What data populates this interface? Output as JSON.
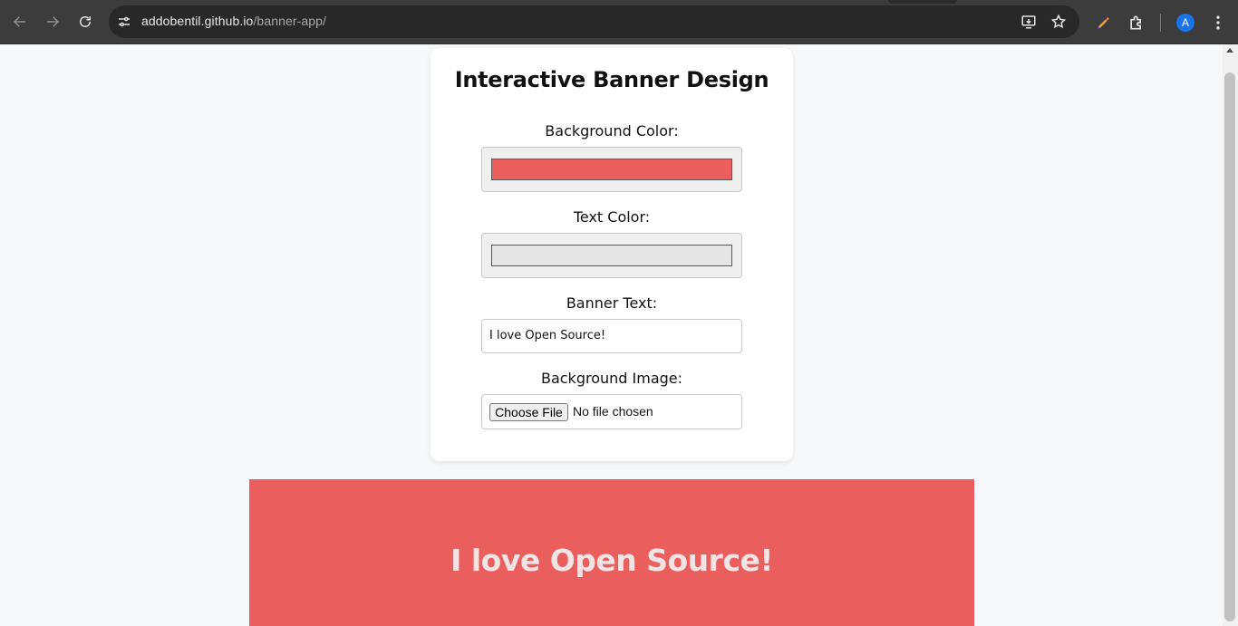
{
  "browser": {
    "url_host": "addobentil.github.io",
    "url_path": "/banner-app/",
    "profile_initial": "A",
    "icons": {
      "back": "arrow-left-icon",
      "forward": "arrow-right-icon",
      "reload": "reload-icon",
      "site_info": "tune-icon",
      "install": "install-app-icon",
      "bookmark": "star-icon",
      "pen": "pen-icon",
      "extensions": "puzzle-icon",
      "menu": "kebab-menu-icon"
    }
  },
  "card": {
    "title": "Interactive Banner Design",
    "background_color_label": "Background Color:",
    "background_color_value": "#eb5e5e",
    "text_color_label": "Text Color:",
    "text_color_value": "#e5e5e5",
    "banner_text_label": "Banner Text:",
    "banner_text_value": "I love Open Source!",
    "background_image_label": "Background Image:",
    "choose_file_label": "Choose File",
    "file_status": "No file chosen"
  },
  "banner": {
    "text": "I love Open Source!",
    "background": "#eb5e5e",
    "color": "#f1e4e4"
  }
}
